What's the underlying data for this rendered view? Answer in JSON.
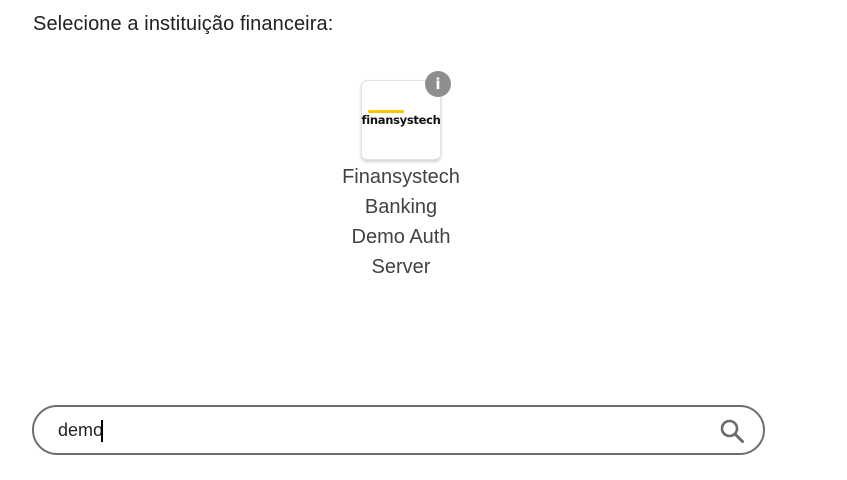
{
  "prompt": "Selecione a instituição financeira:",
  "institutions": [
    {
      "name_lines": [
        "Finansystech",
        "Banking",
        "Demo Auth",
        "Server"
      ],
      "logo_text": "finansystech",
      "info_icon": "info-icon",
      "info_glyph": "i"
    }
  ],
  "search": {
    "value": "demo",
    "placeholder": "",
    "icon": "search-icon"
  },
  "colors": {
    "logo_accent": "#f5c800",
    "info_badge": "#8e8e8e",
    "search_border": "#6e6e6e"
  }
}
